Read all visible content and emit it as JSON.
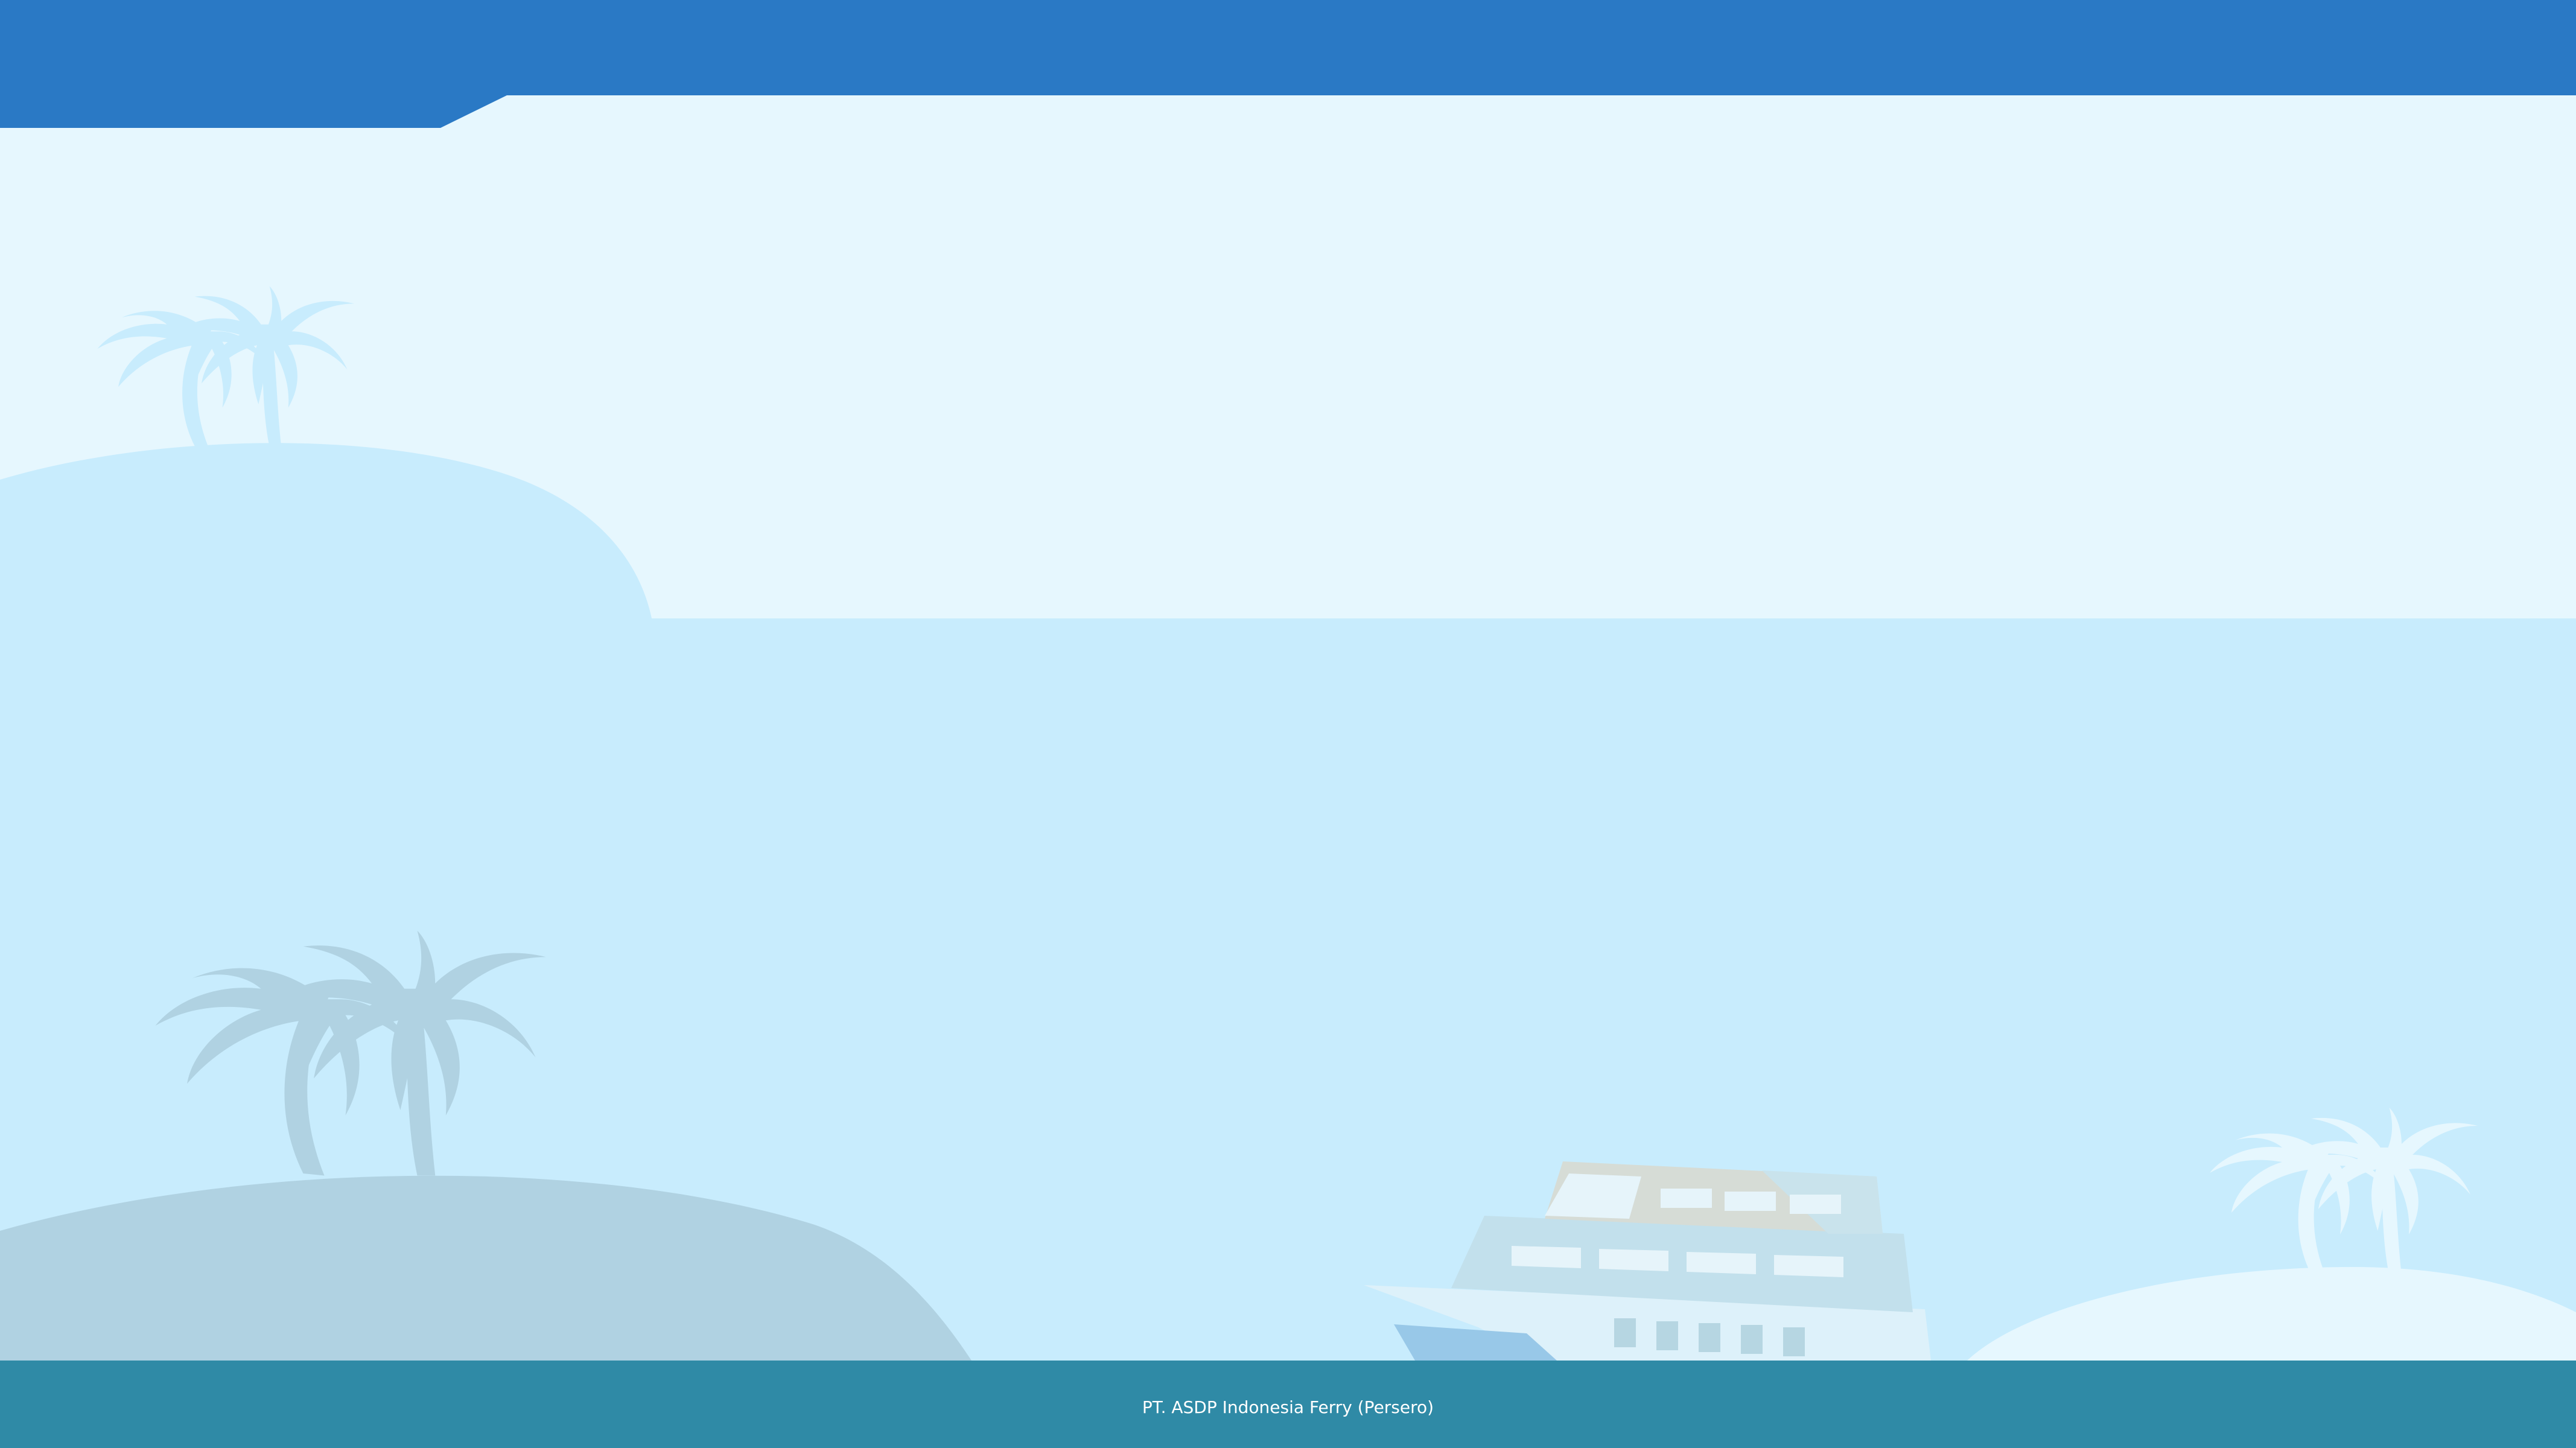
{
  "colors": {
    "header": "#2a79c5",
    "sky": "#e6f7fe",
    "sea": "#c8ecfd",
    "island_left_small": "#c8ecfd",
    "island_left_large": "#b0d2e2",
    "island_right": "#e6f7fe",
    "palm_light": "#c8ecfd",
    "palm_dark": "#b0d2e2",
    "palm_right": "#e6f7fe",
    "footer": "#2f8aa6",
    "footer_text": "#ffffff"
  },
  "footer": {
    "company": "PT. ASDP Indonesia Ferry (Persero)"
  }
}
